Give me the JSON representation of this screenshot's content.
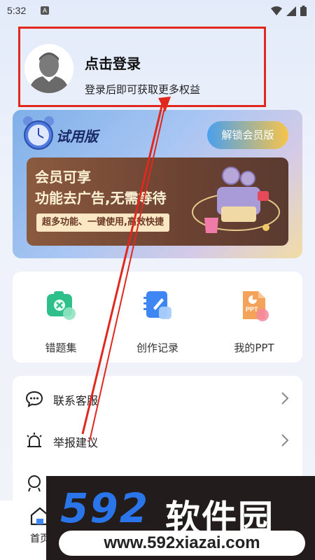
{
  "status_bar": {
    "time": "5:32",
    "notif_badge": "A"
  },
  "profile": {
    "title": "点击登录",
    "subtitle": "登录后即可获取更多权益"
  },
  "member": {
    "trial_label": "试用版",
    "unlock_button": "解锁会员版",
    "promo_line1": "会员可享",
    "promo_line2": "功能去广告,无需等待",
    "promo_tag": "超多功能、一键使用,高效快捷"
  },
  "tools": [
    {
      "label": "错题集",
      "icon": "camera-erase-icon",
      "color": "#2fbf8a"
    },
    {
      "label": "创作记录",
      "icon": "notebook-pen-icon",
      "color": "#3f86f5"
    },
    {
      "label": "我的PPT",
      "icon": "ppt-file-icon",
      "color": "#f5a35a"
    }
  ],
  "menu": [
    {
      "label": "联系客服",
      "icon": "chat-bubble-icon"
    },
    {
      "label": "举报建议",
      "icon": "alarm-report-icon"
    }
  ],
  "bottom_nav": {
    "home_label": "首页"
  },
  "watermark": {
    "logo": "592",
    "brand": "软件园",
    "url": "www.592xiazai.com"
  },
  "colors": {
    "highlight_red": "#e0281f",
    "watermark_blue": "#2a75ea",
    "unlock_gradient_start": "#4aa0ee",
    "unlock_gradient_end": "#f7c44a"
  }
}
